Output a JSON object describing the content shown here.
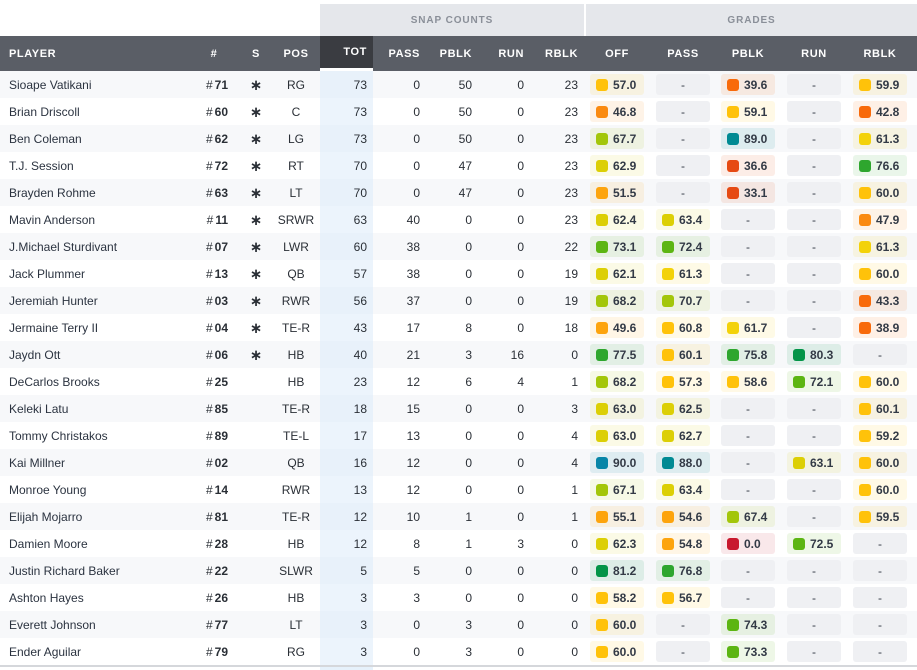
{
  "group_headers": {
    "snap_counts": "SNAP COUNTS",
    "grades": "GRADES"
  },
  "columns": {
    "player": "PLAYER",
    "number": "#",
    "starter": "S",
    "pos": "POS",
    "tot": "TOT",
    "pass": "PASS",
    "pblk": "PBLK",
    "run": "RUN",
    "rblk": "RBLK",
    "g_off": "OFF",
    "g_pass": "PASS",
    "g_pblk": "PBLK",
    "g_run": "RUN",
    "g_rblk": "RBLK"
  },
  "sorted_column": "TOT",
  "starter_glyph": "∗",
  "empty_grade": "-",
  "grade_colors": {
    "red": "#c8192e",
    "dark_orange": "#e64a13",
    "orange_red": "#f86a0a",
    "orange": "#fa8a10",
    "amber": "#fda40e",
    "gold": "#ffc20a",
    "yellow": "#f3d20a",
    "olive_yellow": "#dccf05",
    "yellow_green": "#a3c60a",
    "lime": "#5cb512",
    "green": "#2ea62e",
    "dark_green": "#039448",
    "teal": "#008a93",
    "blue_teal": "#0785a8"
  },
  "rows": [
    {
      "name": "Sioape Vatikani",
      "number": "71",
      "starter": true,
      "pos": "RG",
      "tot": "73",
      "pass": "0",
      "pblk": "50",
      "run": "0",
      "rblk": "23",
      "grades": [
        {
          "v": "57.0",
          "c": "gold"
        },
        null,
        {
          "v": "39.6",
          "c": "orange_red"
        },
        null,
        {
          "v": "59.9",
          "c": "gold"
        }
      ]
    },
    {
      "name": "Brian Driscoll",
      "number": "60",
      "starter": true,
      "pos": "C",
      "tot": "73",
      "pass": "0",
      "pblk": "50",
      "run": "0",
      "rblk": "23",
      "grades": [
        {
          "v": "46.8",
          "c": "orange"
        },
        null,
        {
          "v": "59.1",
          "c": "gold"
        },
        null,
        {
          "v": "42.8",
          "c": "orange_red"
        }
      ]
    },
    {
      "name": "Ben Coleman",
      "number": "62",
      "starter": true,
      "pos": "LG",
      "tot": "73",
      "pass": "0",
      "pblk": "50",
      "run": "0",
      "rblk": "23",
      "grades": [
        {
          "v": "67.7",
          "c": "yellow_green"
        },
        null,
        {
          "v": "89.0",
          "c": "teal"
        },
        null,
        {
          "v": "61.3",
          "c": "yellow"
        }
      ]
    },
    {
      "name": "T.J. Session",
      "number": "72",
      "starter": true,
      "pos": "RT",
      "tot": "70",
      "pass": "0",
      "pblk": "47",
      "run": "0",
      "rblk": "23",
      "grades": [
        {
          "v": "62.9",
          "c": "olive_yellow"
        },
        null,
        {
          "v": "36.6",
          "c": "dark_orange"
        },
        null,
        {
          "v": "76.6",
          "c": "green"
        }
      ]
    },
    {
      "name": "Brayden Rohme",
      "number": "63",
      "starter": true,
      "pos": "LT",
      "tot": "70",
      "pass": "0",
      "pblk": "47",
      "run": "0",
      "rblk": "23",
      "grades": [
        {
          "v": "51.5",
          "c": "amber"
        },
        null,
        {
          "v": "33.1",
          "c": "dark_orange"
        },
        null,
        {
          "v": "60.0",
          "c": "gold"
        }
      ]
    },
    {
      "name": "Mavin Anderson",
      "number": "11",
      "starter": true,
      "pos": "SRWR",
      "tot": "63",
      "pass": "40",
      "pblk": "0",
      "run": "0",
      "rblk": "23",
      "grades": [
        {
          "v": "62.4",
          "c": "olive_yellow"
        },
        {
          "v": "63.4",
          "c": "olive_yellow"
        },
        null,
        null,
        {
          "v": "47.9",
          "c": "orange"
        }
      ]
    },
    {
      "name": "J.Michael Sturdivant",
      "number": "07",
      "starter": true,
      "pos": "LWR",
      "tot": "60",
      "pass": "38",
      "pblk": "0",
      "run": "0",
      "rblk": "22",
      "grades": [
        {
          "v": "73.1",
          "c": "lime"
        },
        {
          "v": "72.4",
          "c": "lime"
        },
        null,
        null,
        {
          "v": "61.3",
          "c": "yellow"
        }
      ]
    },
    {
      "name": "Jack Plummer",
      "number": "13",
      "starter": true,
      "pos": "QB",
      "tot": "57",
      "pass": "38",
      "pblk": "0",
      "run": "0",
      "rblk": "19",
      "grades": [
        {
          "v": "62.1",
          "c": "olive_yellow"
        },
        {
          "v": "61.3",
          "c": "yellow"
        },
        null,
        null,
        {
          "v": "60.0",
          "c": "gold"
        }
      ]
    },
    {
      "name": "Jeremiah Hunter",
      "number": "03",
      "starter": true,
      "pos": "RWR",
      "tot": "56",
      "pass": "37",
      "pblk": "0",
      "run": "0",
      "rblk": "19",
      "grades": [
        {
          "v": "68.2",
          "c": "yellow_green"
        },
        {
          "v": "70.7",
          "c": "yellow_green"
        },
        null,
        null,
        {
          "v": "43.3",
          "c": "orange_red"
        }
      ]
    },
    {
      "name": "Jermaine Terry II",
      "number": "04",
      "starter": true,
      "pos": "TE-R",
      "tot": "43",
      "pass": "17",
      "pblk": "8",
      "run": "0",
      "rblk": "18",
      "grades": [
        {
          "v": "49.6",
          "c": "amber"
        },
        {
          "v": "60.8",
          "c": "gold"
        },
        {
          "v": "61.7",
          "c": "yellow"
        },
        null,
        {
          "v": "38.9",
          "c": "orange_red"
        }
      ]
    },
    {
      "name": "Jaydn Ott",
      "number": "06",
      "starter": true,
      "pos": "HB",
      "tot": "40",
      "pass": "21",
      "pblk": "3",
      "run": "16",
      "rblk": "0",
      "grades": [
        {
          "v": "77.5",
          "c": "green"
        },
        {
          "v": "60.1",
          "c": "gold"
        },
        {
          "v": "75.8",
          "c": "green"
        },
        {
          "v": "80.3",
          "c": "dark_green"
        },
        null
      ]
    },
    {
      "name": "DeCarlos Brooks",
      "number": "25",
      "starter": false,
      "pos": "HB",
      "tot": "23",
      "pass": "12",
      "pblk": "6",
      "run": "4",
      "rblk": "1",
      "grades": [
        {
          "v": "68.2",
          "c": "yellow_green"
        },
        {
          "v": "57.3",
          "c": "gold"
        },
        {
          "v": "58.6",
          "c": "gold"
        },
        {
          "v": "72.1",
          "c": "lime"
        },
        {
          "v": "60.0",
          "c": "gold"
        }
      ]
    },
    {
      "name": "Keleki Latu",
      "number": "85",
      "starter": false,
      "pos": "TE-R",
      "tot": "18",
      "pass": "15",
      "pblk": "0",
      "run": "0",
      "rblk": "3",
      "grades": [
        {
          "v": "63.0",
          "c": "olive_yellow"
        },
        {
          "v": "62.5",
          "c": "olive_yellow"
        },
        null,
        null,
        {
          "v": "60.1",
          "c": "gold"
        }
      ]
    },
    {
      "name": "Tommy Christakos",
      "number": "89",
      "starter": false,
      "pos": "TE-L",
      "tot": "17",
      "pass": "13",
      "pblk": "0",
      "run": "0",
      "rblk": "4",
      "grades": [
        {
          "v": "63.0",
          "c": "olive_yellow"
        },
        {
          "v": "62.7",
          "c": "olive_yellow"
        },
        null,
        null,
        {
          "v": "59.2",
          "c": "gold"
        }
      ]
    },
    {
      "name": "Kai Millner",
      "number": "02",
      "starter": false,
      "pos": "QB",
      "tot": "16",
      "pass": "12",
      "pblk": "0",
      "run": "0",
      "rblk": "4",
      "grades": [
        {
          "v": "90.0",
          "c": "blue_teal"
        },
        {
          "v": "88.0",
          "c": "teal"
        },
        null,
        {
          "v": "63.1",
          "c": "olive_yellow"
        },
        {
          "v": "60.0",
          "c": "gold"
        }
      ]
    },
    {
      "name": "Monroe Young",
      "number": "14",
      "starter": false,
      "pos": "RWR",
      "tot": "13",
      "pass": "12",
      "pblk": "0",
      "run": "0",
      "rblk": "1",
      "grades": [
        {
          "v": "67.1",
          "c": "yellow_green"
        },
        {
          "v": "63.4",
          "c": "olive_yellow"
        },
        null,
        null,
        {
          "v": "60.0",
          "c": "gold"
        }
      ]
    },
    {
      "name": "Elijah Mojarro",
      "number": "81",
      "starter": false,
      "pos": "TE-R",
      "tot": "12",
      "pass": "10",
      "pblk": "1",
      "run": "0",
      "rblk": "1",
      "grades": [
        {
          "v": "55.1",
          "c": "amber"
        },
        {
          "v": "54.6",
          "c": "amber"
        },
        {
          "v": "67.4",
          "c": "yellow_green"
        },
        null,
        {
          "v": "59.5",
          "c": "gold"
        }
      ]
    },
    {
      "name": "Damien Moore",
      "number": "28",
      "starter": false,
      "pos": "HB",
      "tot": "12",
      "pass": "8",
      "pblk": "1",
      "run": "3",
      "rblk": "0",
      "grades": [
        {
          "v": "62.3",
          "c": "olive_yellow"
        },
        {
          "v": "54.8",
          "c": "amber"
        },
        {
          "v": "0.0",
          "c": "red"
        },
        {
          "v": "72.5",
          "c": "lime"
        },
        null
      ]
    },
    {
      "name": "Justin Richard Baker",
      "number": "22",
      "starter": false,
      "pos": "SLWR",
      "tot": "5",
      "pass": "5",
      "pblk": "0",
      "run": "0",
      "rblk": "0",
      "grades": [
        {
          "v": "81.2",
          "c": "dark_green"
        },
        {
          "v": "76.8",
          "c": "green"
        },
        null,
        null,
        null
      ]
    },
    {
      "name": "Ashton Hayes",
      "number": "26",
      "starter": false,
      "pos": "HB",
      "tot": "3",
      "pass": "3",
      "pblk": "0",
      "run": "0",
      "rblk": "0",
      "grades": [
        {
          "v": "58.2",
          "c": "gold"
        },
        {
          "v": "56.7",
          "c": "gold"
        },
        null,
        null,
        null
      ]
    },
    {
      "name": "Everett Johnson",
      "number": "77",
      "starter": false,
      "pos": "LT",
      "tot": "3",
      "pass": "0",
      "pblk": "3",
      "run": "0",
      "rblk": "0",
      "grades": [
        {
          "v": "60.0",
          "c": "gold"
        },
        null,
        {
          "v": "74.3",
          "c": "lime"
        },
        null,
        null
      ]
    },
    {
      "name": "Ender Aguilar",
      "number": "79",
      "starter": false,
      "pos": "RG",
      "tot": "3",
      "pass": "0",
      "pblk": "3",
      "run": "0",
      "rblk": "0",
      "grades": [
        {
          "v": "60.0",
          "c": "gold"
        },
        null,
        {
          "v": "73.3",
          "c": "lime"
        },
        null,
        null
      ]
    }
  ]
}
